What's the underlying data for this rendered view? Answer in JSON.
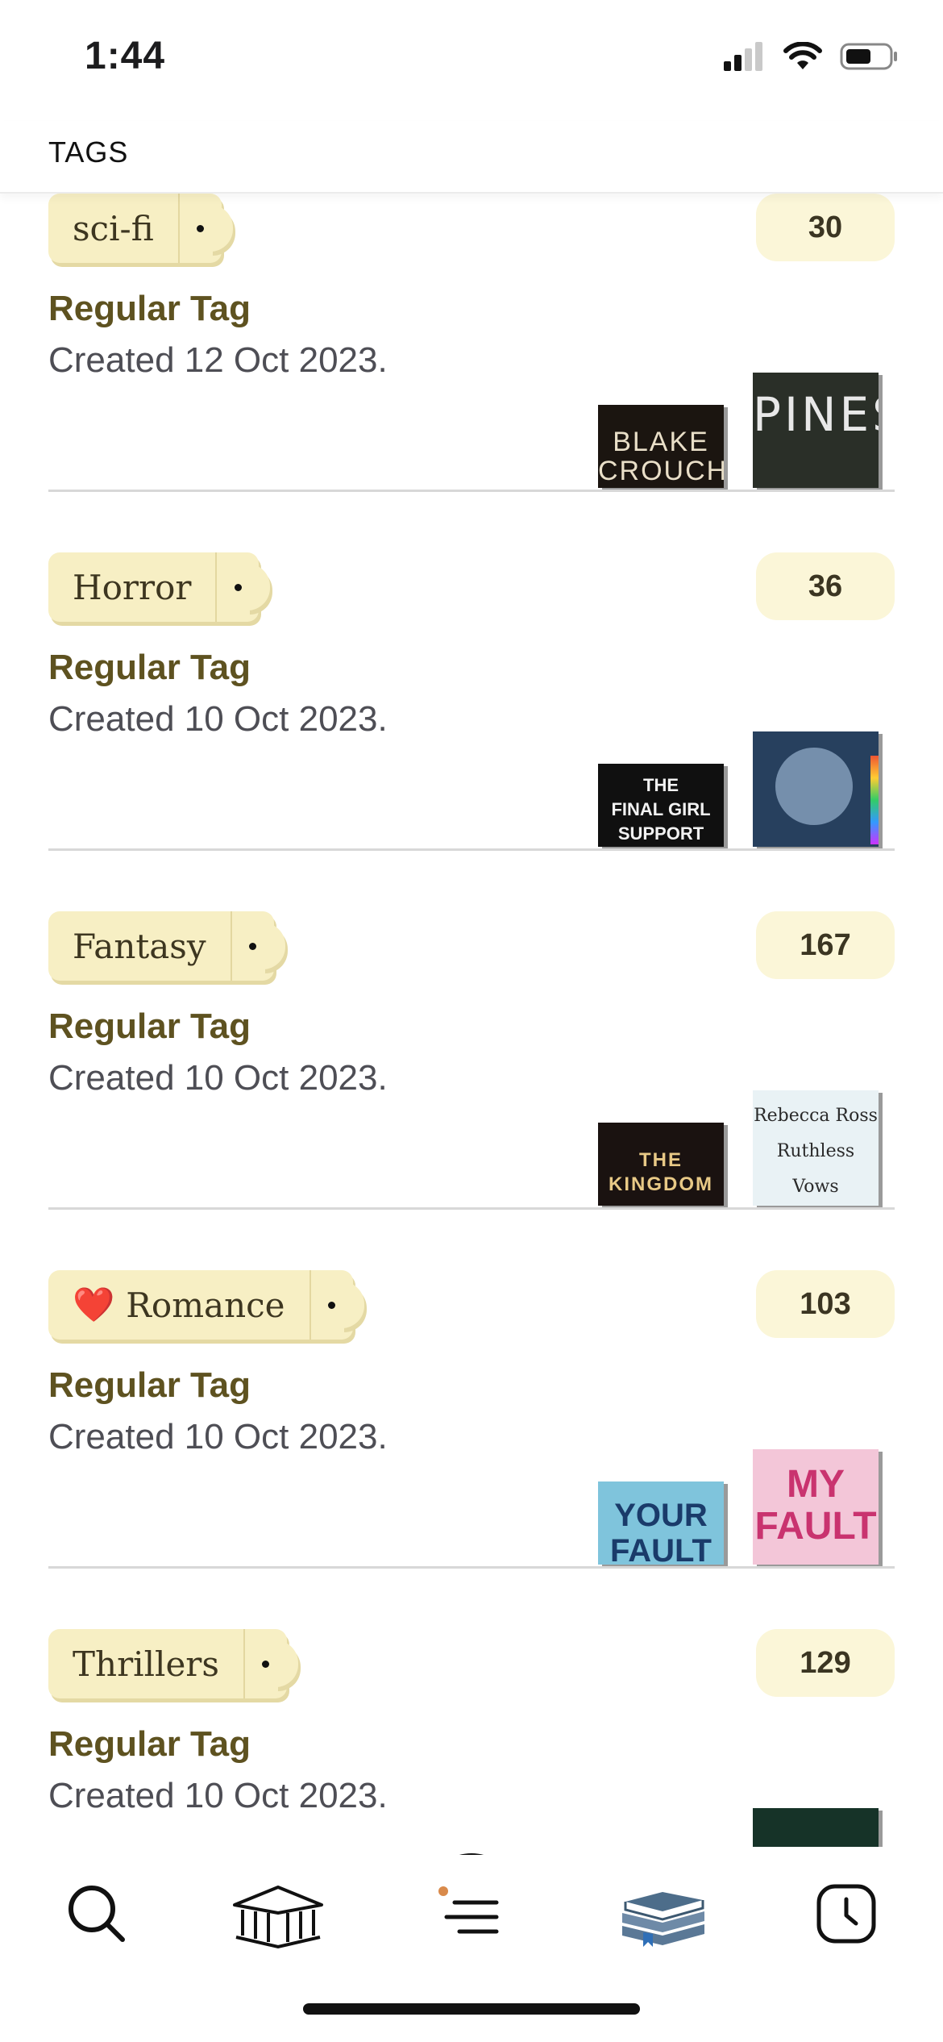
{
  "status_bar": {
    "time": "1:44"
  },
  "header": {
    "title": "TAGS"
  },
  "tags": [
    {
      "name": "sci-fi",
      "heart": "",
      "count": "30",
      "type": "Regular Tag",
      "created": "Created 12 Oct 2023.",
      "covers": [
        {
          "lines": [
            "BLAKE",
            "CROUCH"
          ],
          "bg": "#1b1510",
          "fg": "#e9dfc8"
        },
        {
          "lines": [
            "PINES"
          ],
          "bg": "#2a2f28",
          "fg": "#e8e8e8"
        }
      ]
    },
    {
      "name": "Horror",
      "heart": "",
      "count": "36",
      "type": "Regular Tag",
      "created": "Created 10 Oct 2023.",
      "covers": [
        {
          "lines": [
            "THE",
            "FINAL GIRL",
            "SUPPORT"
          ],
          "bg": "#101010",
          "fg": "#f2f2f2"
        },
        {
          "lines": [],
          "bg": "#27405e",
          "fg": "#ffffff"
        }
      ]
    },
    {
      "name": "Fantasy",
      "heart": "",
      "count": "167",
      "type": "Regular Tag",
      "created": "Created 10 Oct 2023.",
      "covers": [
        {
          "lines": [
            "THE",
            "KINGDOM"
          ],
          "bg": "#1a1210",
          "fg": "#e8c986"
        },
        {
          "lines": [
            "Rebecca Ross",
            "Ruthless",
            "Vows"
          ],
          "bg": "#e9f2f5",
          "fg": "#2a2a2a"
        }
      ]
    },
    {
      "name": "Romance",
      "heart": "❤️",
      "count": "103",
      "type": "Regular Tag",
      "created": "Created 10 Oct 2023.",
      "covers": [
        {
          "lines": [
            "YOUR",
            "FAULT"
          ],
          "bg": "#7fc4dc",
          "fg": "#1a3b6a"
        },
        {
          "lines": [
            "MY",
            "FAULT"
          ],
          "bg": "#f3c6d8",
          "fg": "#c9336f"
        }
      ]
    },
    {
      "name": "Thrillers",
      "heart": "",
      "count": "129",
      "type": "Regular Tag",
      "created": "Created 10 Oct 2023.",
      "covers": [
        {
          "lines": [],
          "bg": "#163328",
          "fg": "#ffffff"
        }
      ]
    }
  ],
  "tab_bar": {
    "items": [
      "search-icon",
      "library-icon",
      "menu-icon",
      "books-icon",
      "clock-icon"
    ],
    "active_color": "#4d6d8a",
    "notification_dot_color": "#d98a4b"
  }
}
